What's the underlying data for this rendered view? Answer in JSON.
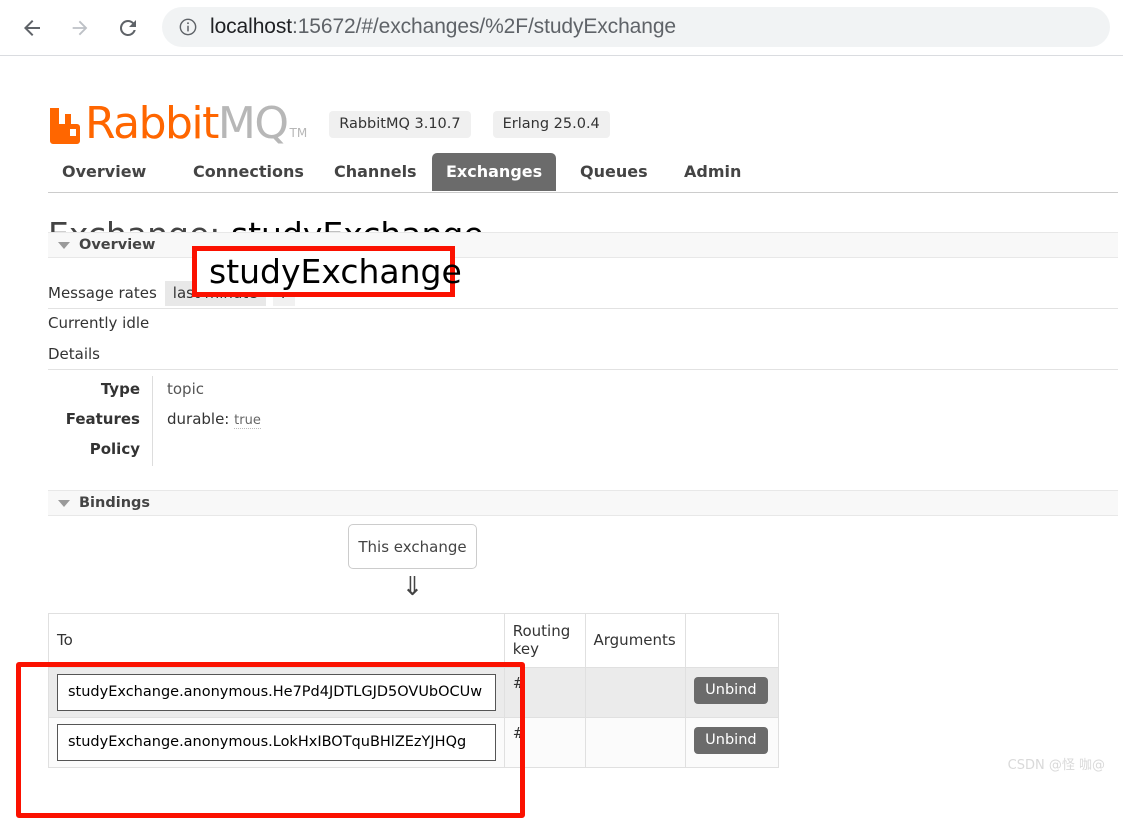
{
  "browser": {
    "back_icon": "arrow-left-icon",
    "forward_icon": "arrow-right-icon",
    "reload_icon": "reload-icon",
    "site_info_icon": "info-circle-icon",
    "url_host": "localhost",
    "url_rest": ":15672/#/exchanges/%2F/studyExchange",
    "url_full": "localhost:15672/#/exchanges/%2F/studyExchange"
  },
  "header": {
    "logo_rabbit": "Rabbit",
    "logo_mq": "MQ",
    "logo_tm": "TM",
    "badges": [
      {
        "label": "RabbitMQ 3.10.7"
      },
      {
        "label": "Erlang 25.0.4"
      }
    ]
  },
  "nav": {
    "tabs": [
      {
        "label": "Overview",
        "active": false
      },
      {
        "label": "Connections",
        "active": false
      },
      {
        "label": "Channels",
        "active": false
      },
      {
        "label": "Exchanges",
        "active": true
      },
      {
        "label": "Queues",
        "active": false
      },
      {
        "label": "Admin",
        "active": false
      }
    ]
  },
  "title": {
    "prefix": "Exchange:",
    "exchange_name": "studyExchange"
  },
  "overview": {
    "section_label": "Overview",
    "message_rates_label": "Message rates",
    "rate_period": "last minute",
    "help_label": "?",
    "status": "Currently idle",
    "details_label": "Details",
    "details": [
      {
        "key": "Type",
        "value": "topic"
      },
      {
        "key": "Features",
        "feature_key": "durable:",
        "feature_value": "true"
      },
      {
        "key": "Policy",
        "value": ""
      }
    ]
  },
  "bindings": {
    "section_label": "Bindings",
    "this_exchange_label": "This exchange",
    "arrow_glyph": "⇓",
    "columns": [
      "To",
      "Routing key",
      "Arguments",
      ""
    ],
    "rows": [
      {
        "to": "studyExchange.anonymous.He7Pd4JDTLGJD5OVUbOCUw",
        "routing_key": "#",
        "arguments": "",
        "action": "Unbind"
      },
      {
        "to": "studyExchange.anonymous.LokHxIBOTquBHlZEzYJHQg",
        "routing_key": "#",
        "arguments": "",
        "action": "Unbind"
      }
    ]
  },
  "annotations": {
    "highlight_color": "#fb1100",
    "title_highlight_text": "studyExchange"
  },
  "watermark": {
    "text": "CSDN @怪 咖@"
  },
  "colors": {
    "brand_orange": "#ff6600",
    "tab_active_bg": "#6b6b6b",
    "annotation_red": "#fb1100"
  }
}
